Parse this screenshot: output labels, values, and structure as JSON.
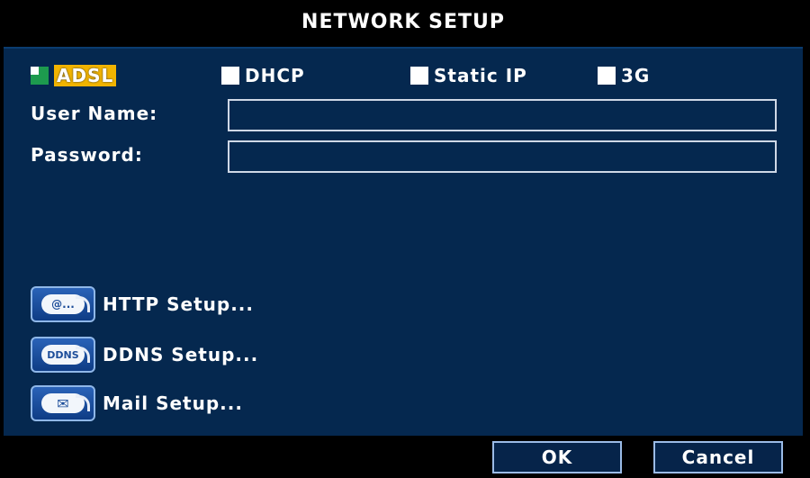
{
  "title": "NETWORK SETUP",
  "modes": [
    {
      "label": "ADSL",
      "checked": true
    },
    {
      "label": "DHCP",
      "checked": false
    },
    {
      "label": "Static IP",
      "checked": false
    },
    {
      "label": "3G",
      "checked": false
    }
  ],
  "fields": {
    "user_name": {
      "label": "User Name:",
      "value": ""
    },
    "password": {
      "label": "Password:",
      "value": ""
    }
  },
  "links": [
    {
      "label": "HTTP Setup...",
      "icon": "email-at-icon",
      "icon_text": "@..."
    },
    {
      "label": "DDNS Setup...",
      "icon": "ddns-icon",
      "icon_text": "DDNS"
    },
    {
      "label": "Mail Setup...",
      "icon": "mail-envelope-icon",
      "icon_text": "✉"
    }
  ],
  "buttons": {
    "ok": "OK",
    "cancel": "Cancel"
  },
  "colors": {
    "panel": "#05284f",
    "selected_highlight": "#f2b400",
    "checked_box": "#1d9a4e"
  }
}
